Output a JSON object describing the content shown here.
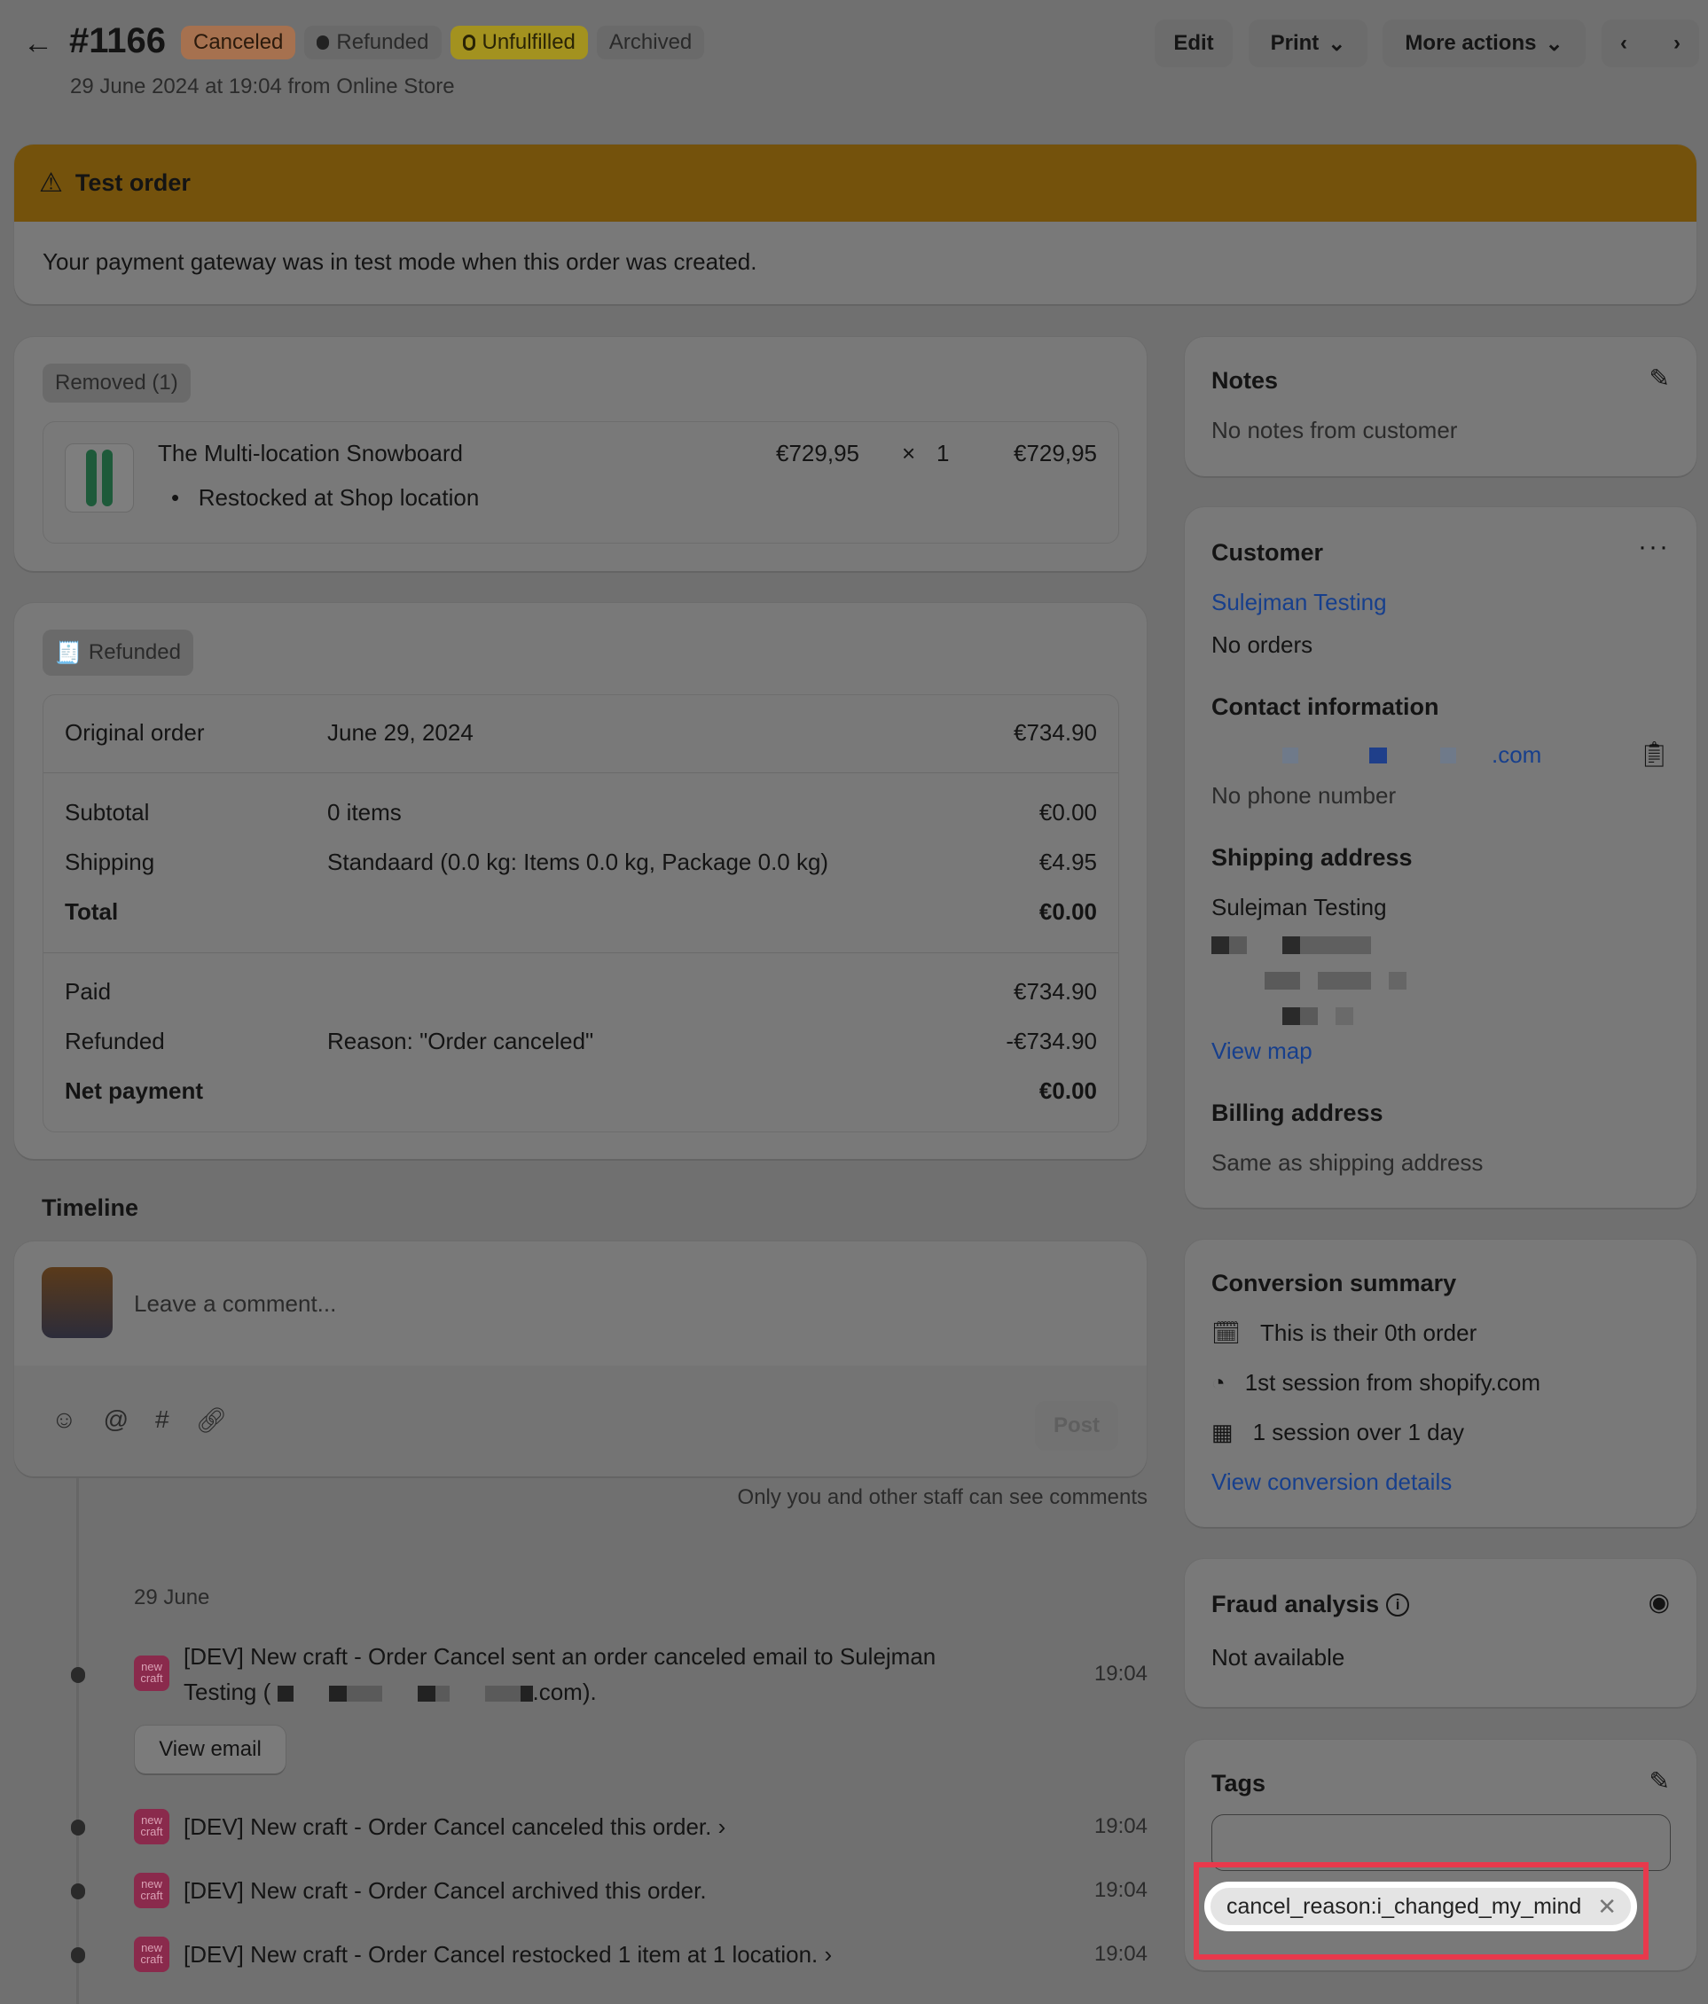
{
  "header": {
    "title": "#1166",
    "subtitle": "29 June 2024 at 19:04 from Online Store",
    "badges": [
      "Canceled",
      "Refunded",
      "Unfulfilled",
      "Archived"
    ],
    "edit": "Edit",
    "print": "Print",
    "more_actions": "More actions"
  },
  "banner": {
    "title": "Test order",
    "message": "Your payment gateway was in test mode when this order was created."
  },
  "removed": {
    "badge": "Removed (1)",
    "item_name": "The Multi-location Snowboard",
    "price": "€729,95",
    "times": "×",
    "qty": "1",
    "total": "€729,95",
    "note": "Restocked at Shop location"
  },
  "refunded": {
    "badge": "Refunded",
    "rows": [
      {
        "label": "Original order",
        "detail": "June 29, 2024",
        "amount": "€734.90"
      },
      {
        "label": "Subtotal",
        "detail": "0 items",
        "amount": "€0.00"
      },
      {
        "label": "Shipping",
        "detail": "Standaard (0.0 kg: Items 0.0 kg, Package 0.0 kg)",
        "amount": "€4.95"
      },
      {
        "label": "Total",
        "detail": "",
        "amount": "€0.00"
      },
      {
        "label": "Paid",
        "detail": "",
        "amount": "€734.90"
      },
      {
        "label": "Refunded",
        "detail": "Reason: \"Order canceled\"",
        "amount": "-€734.90"
      },
      {
        "label": "Net payment",
        "detail": "",
        "amount": "€0.00"
      }
    ]
  },
  "timeline": {
    "title": "Timeline",
    "placeholder": "Leave a comment...",
    "post": "Post",
    "staff_note": "Only you and other staff can see comments",
    "date": "29 June",
    "events": [
      {
        "text": "[DEV] New craft - Order Cancel sent an order canceled email to Sulejman",
        "text2": "Testing (",
        "text3": ".com).",
        "time": "19:04",
        "button": "View email"
      },
      {
        "text": "[DEV] New craft - Order Cancel canceled this order.",
        "time": "19:04"
      },
      {
        "text": "[DEV] New craft - Order Cancel archived this order.",
        "time": "19:04"
      },
      {
        "text": "[DEV] New craft - Order Cancel restocked 1 item at 1 location.",
        "time": "19:04"
      }
    ],
    "app_logo": "new craft"
  },
  "notes": {
    "title": "Notes",
    "text": "No notes from customer"
  },
  "customer": {
    "title": "Customer",
    "name": "Sulejman Testing",
    "orders": "No orders",
    "contact_title": "Contact information",
    "email_suffix": ".com",
    "phone": "No phone number",
    "shipping_title": "Shipping address",
    "shipping_name": "Sulejman Testing",
    "view_map": "View map",
    "billing_title": "Billing address",
    "billing_text": "Same as shipping address"
  },
  "conversion": {
    "title": "Conversion summary",
    "items": [
      "This is their 0th order",
      "1st session from shopify.com",
      "1 session over 1 day"
    ],
    "link": "View conversion details"
  },
  "fraud": {
    "title": "Fraud analysis",
    "text": "Not available"
  },
  "tags": {
    "title": "Tags",
    "tag": "cancel_reason:i_changed_my_mind"
  }
}
